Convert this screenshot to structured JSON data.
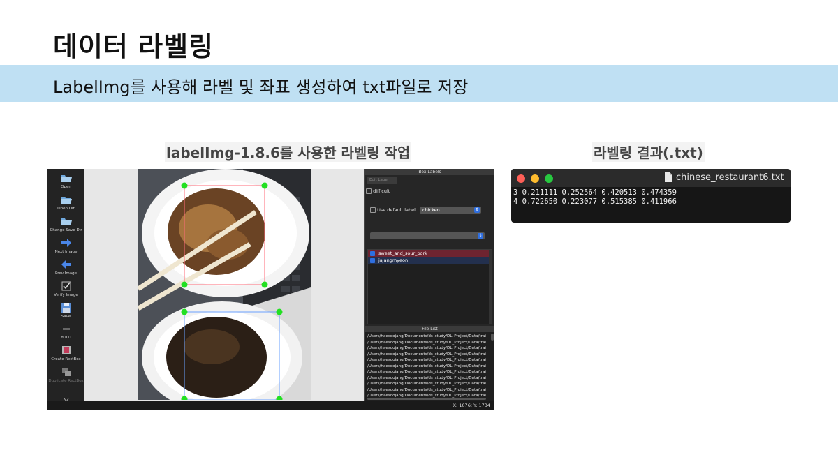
{
  "slide": {
    "title": "데이터 라벨링",
    "subtitle": "LabelImg를 사용해 라벨 및 좌표 생성하여 txt파일로 저장",
    "caption_left": "labelImg-1.8.6를 사용한 라벨링 작업",
    "caption_right": "라벨링 결과(.txt)"
  },
  "labelimg": {
    "toolbar": [
      {
        "label": "Open",
        "icon": "folder-open-icon",
        "enabled": true
      },
      {
        "label": "Open Dir",
        "icon": "folder-open-icon",
        "enabled": true
      },
      {
        "label": "Change Save Dir",
        "icon": "folder-open-icon",
        "enabled": true
      },
      {
        "label": "Next Image",
        "icon": "arrow-right-icon",
        "enabled": true
      },
      {
        "label": "Prev Image",
        "icon": "arrow-left-icon",
        "enabled": true
      },
      {
        "label": "Verify Image",
        "icon": "verify-check-icon",
        "enabled": true
      },
      {
        "label": "Save",
        "icon": "floppy-disk-icon",
        "enabled": true
      },
      {
        "label": "YOLO",
        "icon": "yolo-format-icon",
        "enabled": true
      },
      {
        "label": "Create RectBox",
        "icon": "rectbox-icon",
        "enabled": true
      },
      {
        "label": "Duplicate RectBox",
        "icon": "duplicate-icon",
        "enabled": false
      }
    ],
    "dock_title": "Box Labels",
    "edit_label_tab": "Edit Label",
    "difficult_label": "difficult",
    "use_default_label": "Use default label",
    "default_label_value": "chicken",
    "labels": [
      {
        "name": "sweet_and_sour_pork",
        "color": "#6e2430"
      },
      {
        "name": "jajangmyeon",
        "color": "#23304e"
      }
    ],
    "file_list_title": "File List",
    "files": [
      "/Users/haesoojang/Documents/ds_study/DL_Project/Data/trai",
      "/Users/haesoojang/Documents/ds_study/DL_Project/Data/trai",
      "/Users/haesoojang/Documents/ds_study/DL_Project/Data/trai",
      "/Users/haesoojang/Documents/ds_study/DL_Project/Data/trai",
      "/Users/haesoojang/Documents/ds_study/DL_Project/Data/trai",
      "/Users/haesoojang/Documents/ds_study/DL_Project/Data/trai",
      "/Users/haesoojang/Documents/ds_study/DL_Project/Data/trai",
      "/Users/haesoojang/Documents/ds_study/DL_Project/Data/trai",
      "/Users/haesoojang/Documents/ds_study/DL_Project/Data/trai",
      "/Users/haesoojang/Documents/ds_study/DL_Project/Data/trai",
      "/Users/haesoojang/Documents/ds_study/DL_Project/Data/trai"
    ],
    "status_coords": "X: 1676; Y: 1734"
  },
  "terminal": {
    "filename": "chinese_restaurant6.txt",
    "lines": [
      "3 0.211111 0.252564 0.420513 0.474359",
      "4 0.722650 0.223077 0.515385 0.411966"
    ]
  },
  "colors": {
    "banner": "#bfe0f3",
    "box_handle": "#22e022",
    "close": "#fe5f57",
    "minimize": "#febc2e",
    "maximize": "#28c840"
  }
}
